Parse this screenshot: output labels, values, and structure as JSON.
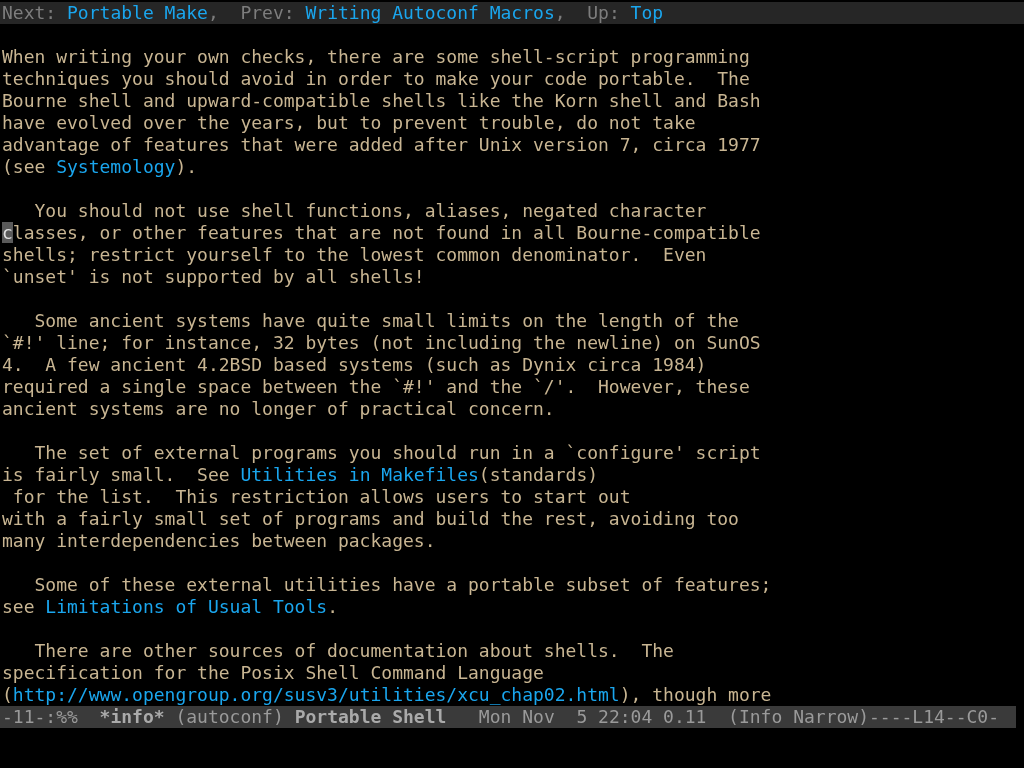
{
  "header_line": [
    {
      "kind": "label",
      "text": "Next: "
    },
    {
      "kind": "link",
      "text": "Portable Make"
    },
    {
      "kind": "label",
      "text": ",  Prev: "
    },
    {
      "kind": "link",
      "text": "Writing Autoconf Macros"
    },
    {
      "kind": "label",
      "text": ",  Up: "
    },
    {
      "kind": "link",
      "text": "Top"
    }
  ],
  "paragraphs": [
    {
      "lines": [
        [
          {
            "kind": "text",
            "text": "When writing your own checks, there are some shell-script programming"
          }
        ],
        [
          {
            "kind": "text",
            "text": "techniques you should avoid in order to make your code portable.  The"
          }
        ],
        [
          {
            "kind": "text",
            "text": "Bourne shell and upward-compatible shells like the Korn shell and Bash"
          }
        ],
        [
          {
            "kind": "text",
            "text": "have evolved over the years, but to prevent trouble, do not take"
          }
        ],
        [
          {
            "kind": "text",
            "text": "advantage of features that were added after Unix version 7, circa 1977"
          }
        ],
        [
          {
            "kind": "text",
            "text": "(see "
          },
          {
            "kind": "link",
            "text": "Systemology"
          },
          {
            "kind": "text",
            "text": ")."
          }
        ]
      ]
    },
    {
      "lines": [
        [
          {
            "kind": "text",
            "text": "   You should not use shell functions, aliases, negated character"
          }
        ],
        [
          {
            "kind": "cursor",
            "text": "c"
          },
          {
            "kind": "text",
            "text": "lasses, or other features that are not found in all Bourne-compatible"
          }
        ],
        [
          {
            "kind": "text",
            "text": "shells; restrict yourself to the lowest common denominator.  Even"
          }
        ],
        [
          {
            "kind": "text",
            "text": "`unset' is not supported by all shells!"
          }
        ]
      ]
    },
    {
      "lines": [
        [
          {
            "kind": "text",
            "text": "   Some ancient systems have quite small limits on the length of the"
          }
        ],
        [
          {
            "kind": "text",
            "text": "`#!' line; for instance, 32 bytes (not including the newline) on SunOS"
          }
        ],
        [
          {
            "kind": "text",
            "text": "4.  A few ancient 4.2BSD based systems (such as Dynix circa 1984)"
          }
        ],
        [
          {
            "kind": "text",
            "text": "required a single space between the `#!' and the `/'.  However, these"
          }
        ],
        [
          {
            "kind": "text",
            "text": "ancient systems are no longer of practical concern."
          }
        ]
      ]
    },
    {
      "lines": [
        [
          {
            "kind": "text",
            "text": "   The set of external programs you should run in a `configure' script"
          }
        ],
        [
          {
            "kind": "text",
            "text": "is fairly small.  See "
          },
          {
            "kind": "link",
            "text": "Utilities in Makefiles"
          },
          {
            "kind": "text",
            "text": "(standards)"
          }
        ],
        [
          {
            "kind": "text",
            "text": " for the list.  This restriction allows users to start out"
          }
        ],
        [
          {
            "kind": "text",
            "text": "with a fairly small set of programs and build the rest, avoiding too"
          }
        ],
        [
          {
            "kind": "text",
            "text": "many interdependencies between packages."
          }
        ]
      ]
    },
    {
      "lines": [
        [
          {
            "kind": "text",
            "text": "   Some of these external utilities have a portable subset of features;"
          }
        ],
        [
          {
            "kind": "text",
            "text": "see "
          },
          {
            "kind": "link",
            "text": "Limitations of Usual Tools"
          },
          {
            "kind": "text",
            "text": "."
          }
        ]
      ]
    },
    {
      "lines": [
        [
          {
            "kind": "text",
            "text": "   There are other sources of documentation about shells.  The"
          }
        ],
        [
          {
            "kind": "text",
            "text": "specification for the Posix Shell Command Language"
          }
        ],
        [
          {
            "kind": "text",
            "text": "("
          },
          {
            "kind": "link",
            "text": "http://www.opengroup.org/susv3/utilities/xcu_chap02.html"
          },
          {
            "kind": "text",
            "text": "), though more"
          }
        ]
      ]
    }
  ],
  "mode_line": [
    {
      "kind": "plain",
      "text": "-11-:%%  "
    },
    {
      "kind": "bold",
      "text": "*info*"
    },
    {
      "kind": "plain",
      "text": " (autoconf) "
    },
    {
      "kind": "bold",
      "text": "Portable Shell"
    },
    {
      "kind": "plain",
      "text": "   Mon Nov  5 22:04 0.11  (Info Narrow)----L14--C0-"
    }
  ]
}
